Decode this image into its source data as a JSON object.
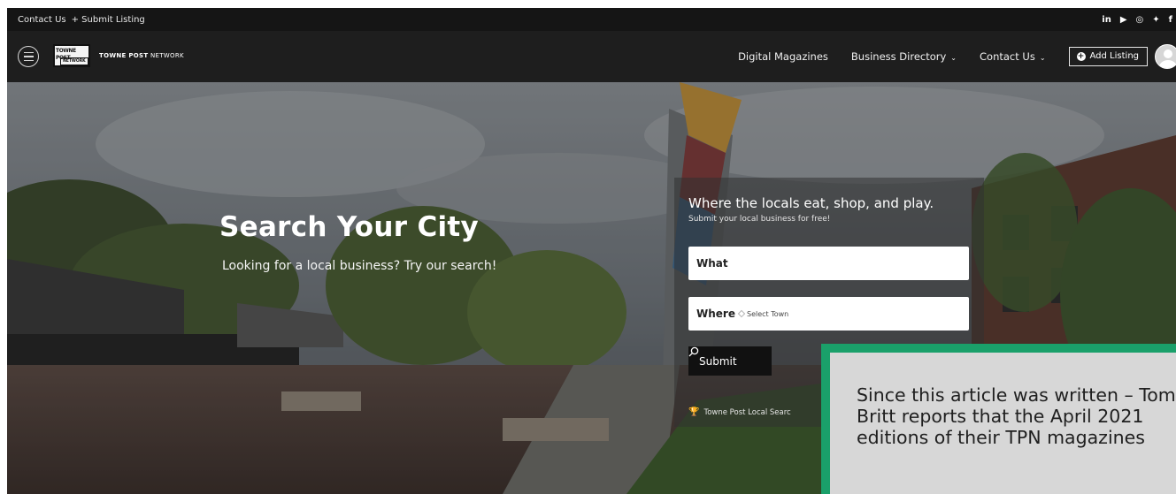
{
  "topbar": {
    "links": [
      "Contact Us",
      "+ Submit Listing"
    ],
    "social": [
      {
        "icon": "linkedin-icon",
        "glyph": "in"
      },
      {
        "icon": "youtube-icon",
        "glyph": "▶"
      },
      {
        "icon": "instagram-icon",
        "glyph": "◎"
      },
      {
        "icon": "twitter-icon",
        "glyph": "✦"
      },
      {
        "icon": "facebook-icon",
        "glyph": "f"
      }
    ]
  },
  "navbar": {
    "logo_badge_top": "TOWNE POST",
    "logo_badge_bottom": "NETWORK",
    "logo_text_bold": "TOWNE POST",
    "logo_text_rest": " NETWORK",
    "links": [
      {
        "label": "Digital Magazines",
        "dropdown": false
      },
      {
        "label": "Business Directory",
        "dropdown": true
      },
      {
        "label": "Contact Us",
        "dropdown": true
      }
    ],
    "add_listing": "Add Listing"
  },
  "hero": {
    "title": "Search Your City",
    "subtitle": "Looking for a local business? Try our search!"
  },
  "search": {
    "title": "Where the locals eat, shop, and play.",
    "subtitle": "Submit your local business for free!",
    "what_label": "What",
    "where_label": "Where",
    "where_value": "Select Town",
    "submit": "Submit",
    "footer": "Towne Post Local Searc"
  },
  "note": {
    "text": "Since this article was written – Tom Britt reports that the April 2021 editions of their TPN magazines"
  },
  "colors": {
    "accent_green": "#1aa06a",
    "trophy": "#f2c230"
  }
}
